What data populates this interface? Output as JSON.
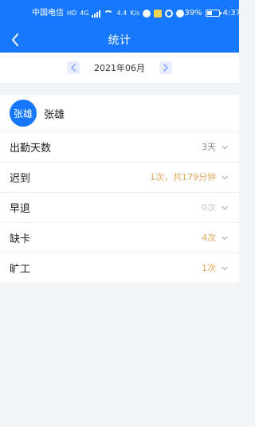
{
  "status_bar": {
    "carrier": "中国电信",
    "network_badge": "HD",
    "network_type": "4G",
    "speed": "4.4",
    "speed_unit": "K/s",
    "battery": "39%",
    "time": "4:37"
  },
  "header": {
    "title": "统计"
  },
  "month_selector": {
    "month": "2021年06月"
  },
  "employee": {
    "avatar_text": "张雄",
    "name": "张雄"
  },
  "stats": [
    {
      "label": "出勤天数",
      "value": "3天",
      "color": "#8a8a8a"
    },
    {
      "label": "迟到",
      "value": "1次，共179分钟",
      "color": "#e0a85a"
    },
    {
      "label": "早退",
      "value": "0次",
      "color": "#c7c7c7"
    },
    {
      "label": "缺卡",
      "value": "4次",
      "color": "#e0a85a"
    },
    {
      "label": "旷工",
      "value": "1次",
      "color": "#e0a85a"
    }
  ],
  "icons": {
    "back": "chevron-left-icon",
    "prev_month": "chevron-left-icon",
    "next_month": "chevron-right-icon",
    "expand": "chevron-down-icon"
  },
  "colors": {
    "primary": "#1677ff",
    "background": "#f3f4f6",
    "card": "#ffffff",
    "accent": "#e0a85a",
    "muted": "#c7c7c7"
  }
}
